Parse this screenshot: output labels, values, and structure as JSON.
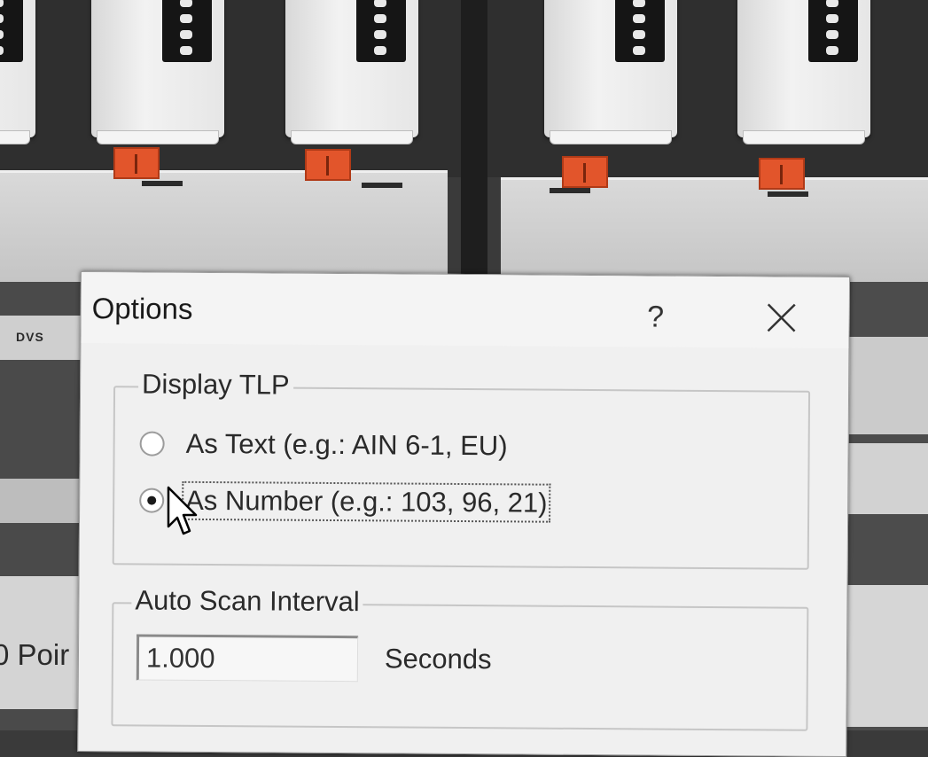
{
  "background": {
    "panel_label": "DVS",
    "partial_text": "0 Poir"
  },
  "dialog": {
    "title": "Options",
    "help_label": "?",
    "close_icon": "close-icon",
    "display_group": {
      "legend": "Display TLP",
      "options": [
        {
          "label": "As Text (e.g.: AIN 6-1, EU)",
          "checked": false
        },
        {
          "label": "As Number (e.g.: 103, 96, 21)",
          "checked": true
        }
      ]
    },
    "scan_group": {
      "legend": "Auto Scan Interval",
      "value": "1.000",
      "units": "Seconds"
    }
  },
  "colors": {
    "latch": "#e2552b",
    "dialog_bg": "#f0f0f0"
  }
}
